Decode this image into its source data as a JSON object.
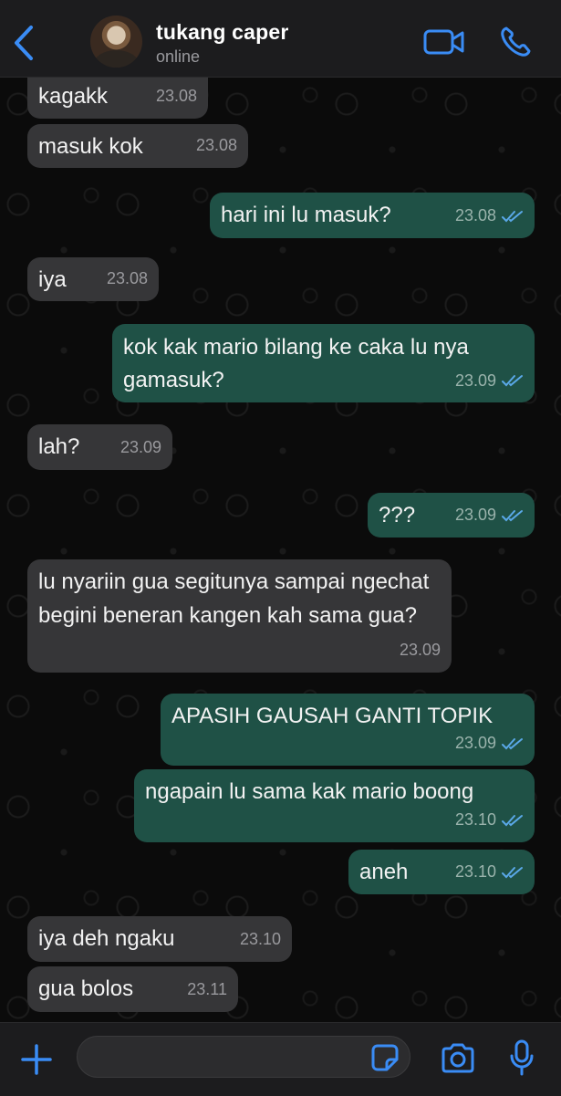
{
  "header": {
    "contact_name": "tukang caper",
    "status": "online",
    "icons": [
      "chevron-left-icon",
      "avatar",
      "video-call-icon",
      "phone-icon"
    ]
  },
  "colors": {
    "accent": "#3a8cf5",
    "incoming_bubble": "#363638",
    "outgoing_bubble": "#1f5146",
    "read_ticks": "#5aa8e8"
  },
  "messages": [
    {
      "direction": "in",
      "text": "kagakk",
      "time": "23.08"
    },
    {
      "direction": "in",
      "text": "masuk kok",
      "time": "23.08"
    },
    {
      "direction": "out",
      "text": "hari ini lu masuk?",
      "time": "23.08",
      "status": "read"
    },
    {
      "direction": "in",
      "text": "iya",
      "time": "23.08"
    },
    {
      "direction": "out",
      "text": "kok kak mario bilang ke caka lu nya gamasuk?",
      "time": "23.09",
      "status": "read"
    },
    {
      "direction": "in",
      "text": "lah?",
      "time": "23.09"
    },
    {
      "direction": "out",
      "text": "???",
      "time": "23.09",
      "status": "read"
    },
    {
      "direction": "in",
      "text": "lu nyariin gua segitunya sampai ngechat begini beneran kangen kah sama gua?",
      "time": "23.09"
    },
    {
      "direction": "out",
      "text": "APASIH GAUSAH GANTI TOPIK",
      "time": "23.09",
      "status": "read"
    },
    {
      "direction": "out",
      "text": "ngapain lu sama kak mario boong",
      "time": "23.10",
      "status": "read"
    },
    {
      "direction": "out",
      "text": "aneh",
      "time": "23.10",
      "status": "read"
    },
    {
      "direction": "in",
      "text": "iya deh ngaku",
      "time": "23.10"
    },
    {
      "direction": "in",
      "text": "gua bolos",
      "time": "23.11"
    }
  ],
  "composer": {
    "input_value": "",
    "icons": [
      "plus-icon",
      "sticker-icon",
      "camera-icon",
      "microphone-icon"
    ]
  }
}
